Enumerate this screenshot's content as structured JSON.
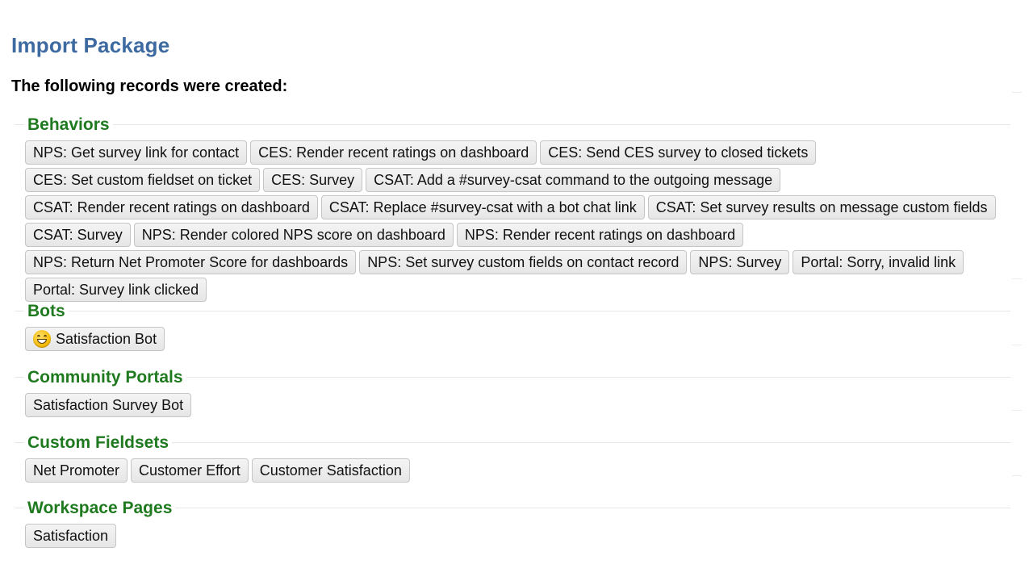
{
  "page": {
    "title": "Import Package",
    "subheading": "The following records were created:"
  },
  "sections": {
    "behaviors": {
      "title": "Behaviors",
      "items": [
        "NPS: Get survey link for contact",
        "CES: Render recent ratings on dashboard",
        "CES: Send CES survey to closed tickets",
        "CES: Set custom fieldset on ticket",
        "CES: Survey",
        "CSAT: Add a #survey-csat command to the outgoing message",
        "CSAT: Render recent ratings on dashboard",
        "CSAT: Replace #survey-csat with a bot chat link",
        "CSAT: Set survey results on message custom fields",
        "CSAT: Survey",
        "NPS: Render colored NPS score on dashboard",
        "NPS: Render recent ratings on dashboard",
        "NPS: Return Net Promoter Score for dashboards",
        "NPS: Set survey custom fields on contact record",
        "NPS: Survey",
        "Portal: Sorry, invalid link",
        "Portal: Survey link clicked"
      ]
    },
    "bots": {
      "title": "Bots",
      "items": [
        {
          "label": "Satisfaction Bot",
          "icon": "grinning-face-emoji-icon"
        }
      ]
    },
    "community_portals": {
      "title": "Community Portals",
      "items": [
        "Satisfaction Survey Bot"
      ]
    },
    "custom_fieldsets": {
      "title": "Custom Fieldsets",
      "items": [
        "Net Promoter",
        "Customer Effort",
        "Customer Satisfaction"
      ]
    },
    "workspace_pages": {
      "title": "Workspace Pages",
      "items": [
        "Satisfaction"
      ]
    }
  },
  "colors": {
    "page_title": "#3d6aa1",
    "section_title": "#1f7a1f",
    "chip_background": "#ececec",
    "chip_border": "#c5c5c5"
  }
}
